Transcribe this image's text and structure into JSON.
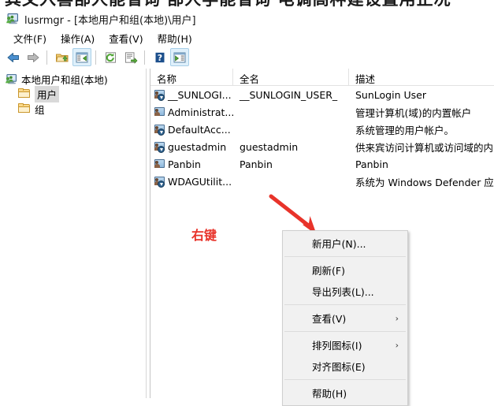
{
  "cutoff_strip": {
    "text": "其文入喜部人能省询  部人学能省询   电调高种建设置用正况"
  },
  "window": {
    "title": "lusrmgr - [本地用户和组(本地)\\用户]",
    "title_icon": "computer-users-icon"
  },
  "menubar": {
    "items": [
      {
        "label": "文件(F)",
        "name": "menu-file"
      },
      {
        "label": "操作(A)",
        "name": "menu-action"
      },
      {
        "label": "查看(V)",
        "name": "menu-view"
      },
      {
        "label": "帮助(H)",
        "name": "menu-help"
      }
    ]
  },
  "toolbar": {
    "buttons": [
      {
        "name": "back-button",
        "icon": "left-arrow-icon",
        "active": false
      },
      {
        "name": "forward-button",
        "icon": "right-arrow-icon",
        "active": false
      },
      {
        "name": "up-folder-button",
        "icon": "folder-up-icon",
        "active": false
      },
      {
        "name": "show-hide-tree-button",
        "icon": "console-tree-icon",
        "active": true
      },
      {
        "name": "refresh-button",
        "icon": "refresh-icon",
        "active": false
      },
      {
        "name": "export-list-button",
        "icon": "export-list-icon",
        "active": false
      },
      {
        "name": "help-button",
        "icon": "question-mark-icon",
        "active": false
      },
      {
        "name": "show-action-pane-button",
        "icon": "action-pane-icon",
        "active": true
      }
    ]
  },
  "tree": {
    "items": [
      {
        "label": "本地用户和组(本地)",
        "icon": "computer-users-icon",
        "indent": false,
        "selected": false
      },
      {
        "label": "用户",
        "icon": "folder-icon",
        "indent": true,
        "selected": true
      },
      {
        "label": "组",
        "icon": "folder-icon",
        "indent": true,
        "selected": false
      }
    ]
  },
  "list": {
    "columns": [
      {
        "label": "名称",
        "name": "column-header-name"
      },
      {
        "label": "全名",
        "name": "column-header-fullname"
      },
      {
        "label": "描述",
        "name": "column-header-description"
      }
    ],
    "rows": [
      {
        "name": "__SUNLOGI...",
        "fullname": "__SUNLOGIN_USER_",
        "description": "SunLogin User",
        "icon": "user-disabled-icon"
      },
      {
        "name": "Administrat...",
        "fullname": "",
        "description": "管理计算机(域)的内置帐户",
        "icon": "user-icon"
      },
      {
        "name": "DefaultAcc...",
        "fullname": "",
        "description": "系统管理的用户帐户。",
        "icon": "user-disabled-icon"
      },
      {
        "name": "guestadmin",
        "fullname": "guestadmin",
        "description": "供来宾访问计算机或访问域的内...",
        "icon": "user-disabled-icon"
      },
      {
        "name": "Panbin",
        "fullname": "Panbin",
        "description": "Panbin",
        "icon": "user-icon"
      },
      {
        "name": "WDAGUtilit...",
        "fullname": "",
        "description": "系统为 Windows Defender 应用",
        "icon": "user-disabled-icon"
      }
    ]
  },
  "annotation": {
    "label": "右键",
    "color": "#e8332a",
    "arrow_name": "red-pointer-arrow"
  },
  "context_menu": {
    "items": [
      {
        "label": "新用户(N)...",
        "name": "context-menu-new-user",
        "submenu": false,
        "separator_after": true
      },
      {
        "label": "刷新(F)",
        "name": "context-menu-refresh",
        "submenu": false,
        "separator_after": false
      },
      {
        "label": "导出列表(L)...",
        "name": "context-menu-export-list",
        "submenu": false,
        "separator_after": true
      },
      {
        "label": "查看(V)",
        "name": "context-menu-view",
        "submenu": true,
        "separator_after": true
      },
      {
        "label": "排列图标(I)",
        "name": "context-menu-arrange-icons",
        "submenu": true,
        "separator_after": false
      },
      {
        "label": "对齐图标(E)",
        "name": "context-menu-align-icons",
        "submenu": false,
        "separator_after": true
      },
      {
        "label": "帮助(H)",
        "name": "context-menu-help",
        "submenu": false,
        "separator_after": false
      }
    ],
    "submenu_glyph": "›"
  }
}
